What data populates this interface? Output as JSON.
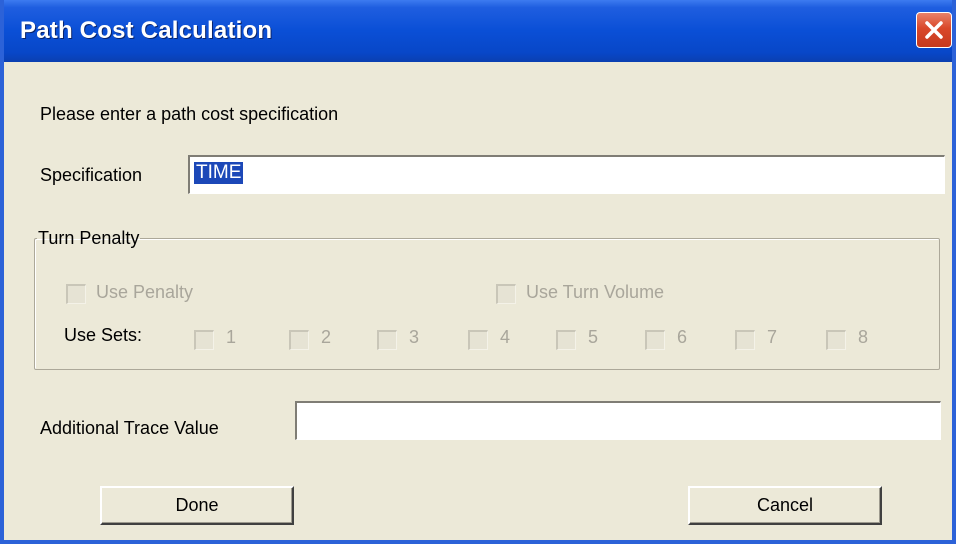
{
  "window": {
    "title": "Path Cost Calculation"
  },
  "prompt": "Please enter a path cost specification",
  "specification": {
    "label": "Specification",
    "value": "TIME"
  },
  "turn_penalty": {
    "legend": "Turn Penalty",
    "use_penalty": {
      "label": "Use Penalty",
      "checked": false,
      "enabled": false
    },
    "use_turn_volume": {
      "label": "Use Turn Volume",
      "checked": false,
      "enabled": false
    },
    "use_sets_label": "Use Sets:",
    "sets": [
      "1",
      "2",
      "3",
      "4",
      "5",
      "6",
      "7",
      "8"
    ]
  },
  "additional_trace": {
    "label": "Additional Trace Value",
    "value": ""
  },
  "buttons": {
    "done": "Done",
    "cancel": "Cancel"
  },
  "colors": {
    "titlebar": "#0a4fd6",
    "dialog_bg": "#ece9d8",
    "close_button": "#d9482a",
    "selection": "#1c48b8"
  }
}
